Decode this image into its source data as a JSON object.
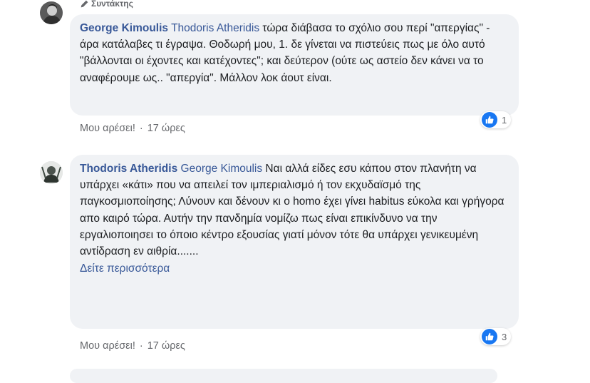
{
  "comment1": {
    "role_label": "Συντάκτης",
    "author": "George Kimoulis",
    "mention": "Thodoris Atheridis",
    "text": " τώρα διάβασα το σχόλιο σου περί \"απεργίας\" - άρα κατάλαβες τι έγραψα. Θοδωρή μου, 1. δε γίνεται να πιστεύεις πως με όλο αυτό \"βάλλονται οι έχοντες και κατέχοντες\"; και δεύτερον (ούτε ως αστείο δεν κάνει να το αναφέρουμε ως.. \"απεργία\". Μάλλον λοκ άουτ είναι.",
    "like_label": "Μου αρέσει!",
    "separator": "·",
    "time": "17 ώρες",
    "reaction_count": "1"
  },
  "comment2": {
    "author": "Thodoris Atheridis",
    "mention": "George Kimoulis",
    "text": " Ναι αλλά είδες εσυ κάπου στον πλανήτη να υπάρχει «κάτι» που να απειλεί τον ιμπεριαλισμό ή τον εκχυδαϊσμό της παγκοσμιοποίησης; Λύνουν και δένουν κι ο homo έχει γίνει habitus εύκολα και γρήγορα απο καιρό τώρα. Αυτήν την πανδημία νομίζω πως είναι επικίνδυνο να την εργαλιοποιησει το όποιο κέντρο εξουσίας γιατί μόνον τότε θα υπάρχει γενικευμένη αντίδραση εν αιθρία.......",
    "see_more": "Δείτε περισσότερα",
    "like_label": "Μου αρέσει!",
    "separator": "·",
    "time": "17 ώρες",
    "reaction_count": "3"
  },
  "colors": {
    "bubble": "#f0f2f5",
    "link": "#385898",
    "like_blue": "#1877f2",
    "meta": "#65676b"
  },
  "icons": [
    "pencil-icon",
    "like-icon"
  ]
}
